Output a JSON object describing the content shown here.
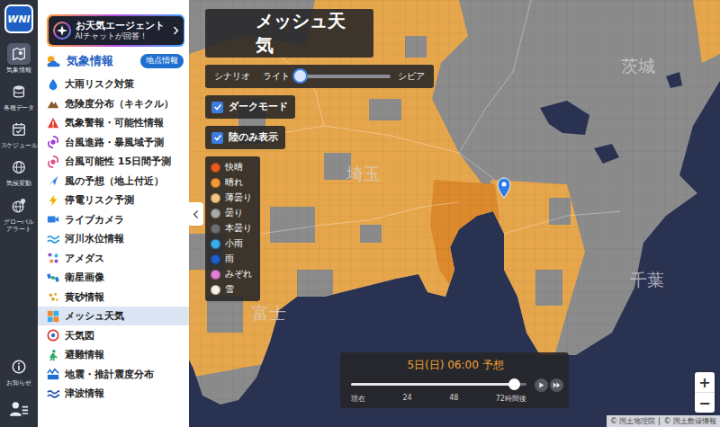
{
  "rail": {
    "logo": "WNI",
    "items": [
      {
        "label": "気象情報",
        "selected": true
      },
      {
        "label": "各種データ",
        "selected": false
      },
      {
        "label": "スケジュール",
        "selected": false
      },
      {
        "label": "気候変動",
        "selected": false
      },
      {
        "label": "グローバル\nアラート",
        "selected": false
      }
    ],
    "footer": {
      "label": "お知らせ"
    }
  },
  "agent": {
    "title": "お天気エージェント",
    "subtitle": "AIチャットが回答！"
  },
  "panel": {
    "title": "気象情報",
    "button": "地点情報",
    "items": [
      {
        "label": "大雨リスク対策",
        "selected": false
      },
      {
        "label": "危険度分布（キキクル）",
        "selected": false
      },
      {
        "label": "気象警報・可能性情報",
        "selected": false
      },
      {
        "label": "台風進路・暴風域予測",
        "selected": false
      },
      {
        "label": "台風可能性 15日間予測",
        "selected": false
      },
      {
        "label": "風の予想（地上付近）",
        "selected": false
      },
      {
        "label": "停電リスク予測",
        "selected": false
      },
      {
        "label": "ライブカメラ",
        "selected": false
      },
      {
        "label": "河川水位情報",
        "selected": false
      },
      {
        "label": "アメダス",
        "selected": false
      },
      {
        "label": "衛星画像",
        "selected": false
      },
      {
        "label": "黄砂情報",
        "selected": false
      },
      {
        "label": "メッシュ天気",
        "selected": true
      },
      {
        "label": "天気図",
        "selected": false
      },
      {
        "label": "避難情報",
        "selected": false
      },
      {
        "label": "地震・推計震度分布",
        "selected": false
      },
      {
        "label": "津波情報",
        "selected": false
      }
    ]
  },
  "map": {
    "title": "メッシュ天気",
    "scenario": {
      "label": "シナリオ",
      "min": "ライト",
      "max": "シビア",
      "level": 0.03
    },
    "toggles": [
      {
        "label": "ダークモード",
        "checked": true
      },
      {
        "label": "陸のみ表示",
        "checked": true
      }
    ],
    "legend": [
      {
        "label": "快晴",
        "color": "#ea5a1c"
      },
      {
        "label": "晴れ",
        "color": "#f29a36"
      },
      {
        "label": "薄曇り",
        "color": "#f3c77e"
      },
      {
        "label": "曇り",
        "color": "#a9a9a9"
      },
      {
        "label": "本曇り",
        "color": "#6f6f6f"
      },
      {
        "label": "小雨",
        "color": "#39aee9"
      },
      {
        "label": "雨",
        "color": "#1f5fc9"
      },
      {
        "label": "みぞれ",
        "color": "#e37cd9"
      },
      {
        "label": "雪",
        "color": "#f4f3ea"
      }
    ],
    "labels": [
      {
        "text": "埼玉"
      },
      {
        "text": "茨城"
      },
      {
        "text": "千葉"
      },
      {
        "text": "富士"
      }
    ]
  },
  "timeline": {
    "time": "5日(日) 06:00 予想",
    "level": 0.93,
    "ticks": [
      "現在",
      "24",
      "48",
      "72時間後"
    ]
  },
  "zoom": [
    "+",
    "−"
  ],
  "attribution": [
    "© 国土地理院",
    "© 国土数値情報"
  ]
}
